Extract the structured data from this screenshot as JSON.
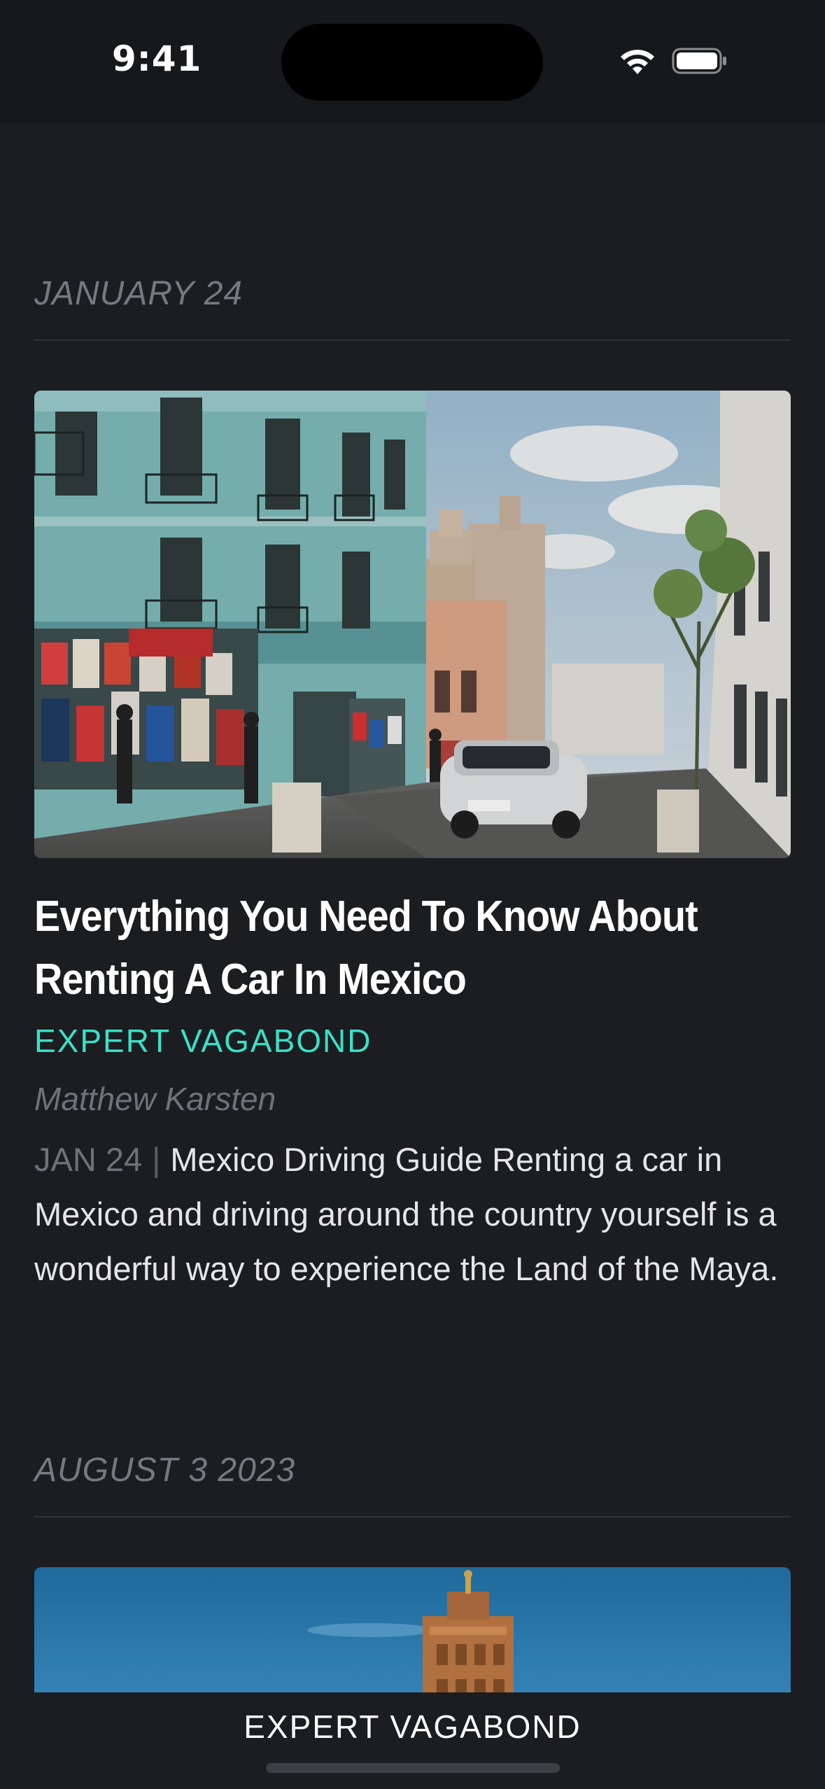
{
  "status_bar": {
    "time": "9:41"
  },
  "sections": [
    {
      "date_header": "JANUARY 24",
      "article": {
        "image_alt": "Colorful colonial street in Mexico with market stalls and a white car",
        "title": "Everything You Need To Know About Renting A Car In Mexico",
        "category": "EXPERT VAGABOND",
        "author": "Matthew Karsten",
        "date": "JAN 24",
        "separator": "|",
        "excerpt": "Mexico Driving Guide Renting a car in Mexico and driving around the country yourself is a wonderful way to experience the Land of the Maya."
      }
    },
    {
      "date_header": "AUGUST 3 2023",
      "article": {
        "image_alt": "Minaret tower against a blue sky"
      }
    }
  ],
  "bottom_nav": {
    "label": "EXPERT VAGABOND"
  },
  "colors": {
    "background": "#1b1d20",
    "accent": "#3be0c8",
    "muted_text": "#767a80"
  }
}
